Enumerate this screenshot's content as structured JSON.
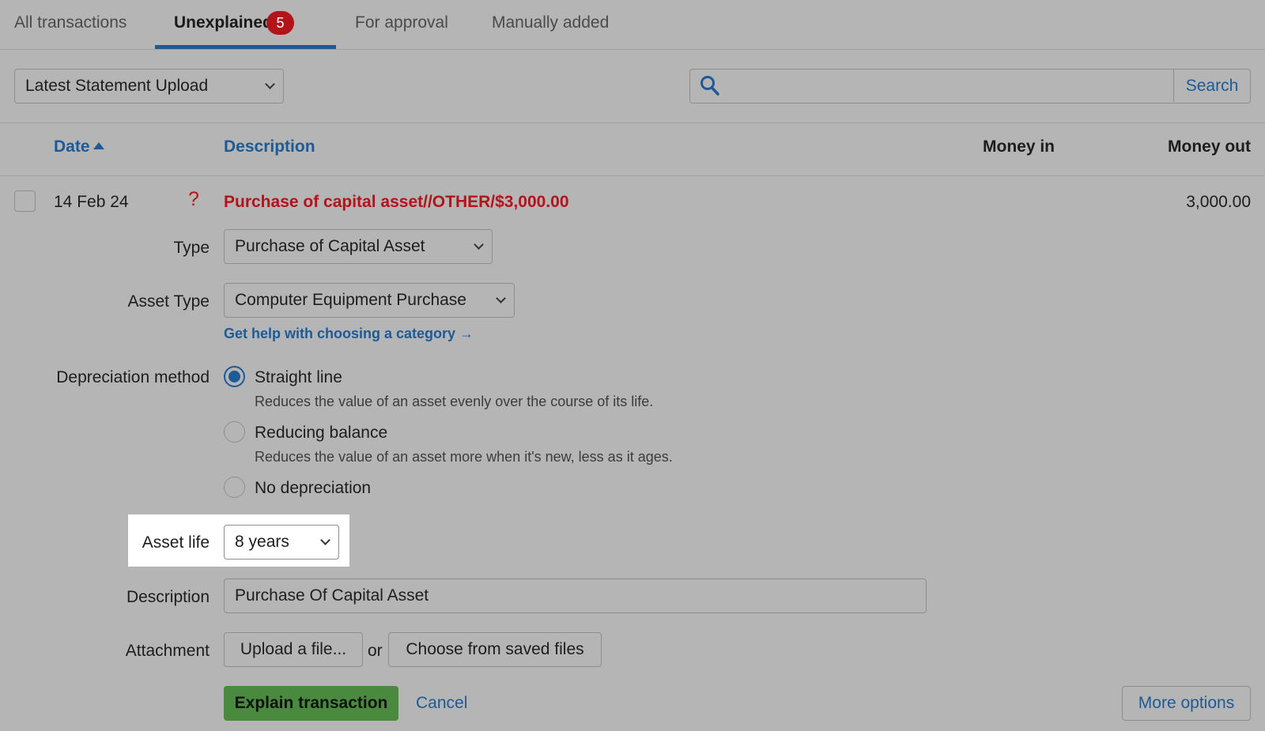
{
  "tabs": [
    {
      "label": "All transactions"
    },
    {
      "label": "Unexplained",
      "badge": "5"
    },
    {
      "label": "For approval"
    },
    {
      "label": "Manually added"
    }
  ],
  "filter": {
    "statement_select": "Latest Statement Upload",
    "search_value": "",
    "search_button": "Search"
  },
  "table": {
    "headers": {
      "date": "Date",
      "description": "Description",
      "money_in": "Money in",
      "money_out": "Money out"
    },
    "row": {
      "date": "14 Feb 24",
      "status_mark": "?",
      "description": "Purchase of capital asset//OTHER/$3,000.00",
      "money_in": "",
      "money_out": "3,000.00"
    }
  },
  "form": {
    "type_label": "Type",
    "type_value": "Purchase of Capital Asset",
    "asset_type_label": "Asset Type",
    "asset_type_value": "Computer Equipment Purchase",
    "help_link": "Get help with choosing a category →",
    "depreciation_label": "Depreciation method",
    "depreciation_options": [
      {
        "label": "Straight line",
        "hint": "Reduces the value of an asset evenly over the course of its life.",
        "checked": true
      },
      {
        "label": "Reducing balance",
        "hint": "Reduces the value of an asset more when it's new, less as it ages.",
        "checked": false
      },
      {
        "label": "No depreciation",
        "hint": "",
        "checked": false
      }
    ],
    "asset_life_label": "Asset life",
    "asset_life_value": "8 years",
    "description_label": "Description",
    "description_value": "Purchase Of Capital Asset",
    "attachment_label": "Attachment",
    "upload_button": "Upload a file...",
    "or_text": "or",
    "saved_files_button": "Choose from saved files",
    "explain_button": "Explain transaction",
    "cancel_link": "Cancel",
    "more_options_button": "More options"
  },
  "colors": {
    "background": "#b5b5b5",
    "accent_blue": "#1d5a96",
    "alert_red": "#b3141b",
    "primary_green": "#4a8a3e"
  }
}
